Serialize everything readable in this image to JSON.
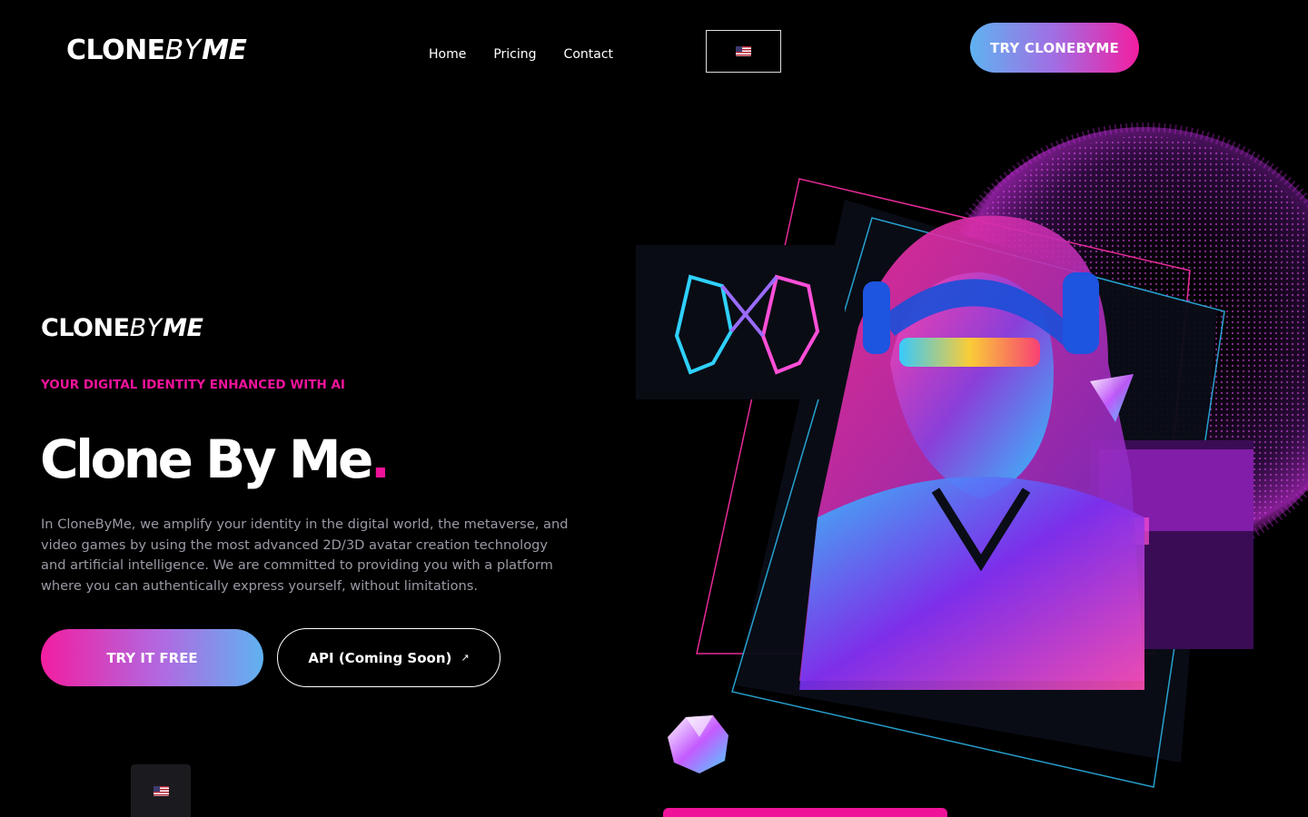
{
  "header": {
    "logo": {
      "clone": "CLONE",
      "by": "BY",
      "me": "ME"
    },
    "nav": [
      {
        "label": "Home"
      },
      {
        "label": "Pricing"
      },
      {
        "label": "Contact"
      }
    ],
    "language_icon": "us-flag-icon",
    "cta_label": "TRY CLONEBYME"
  },
  "hero": {
    "logo": {
      "clone": "CLONE",
      "by": "BY",
      "me": "ME"
    },
    "tagline": "YOUR DIGITAL IDENTITY ENHANCED WITH AI",
    "headline": "Clone By Me",
    "headline_dot": ".",
    "description": "In CloneByMe, we amplify your identity in the digital world, the metaverse, and video games by using the most advanced 2D/3D avatar creation technology and artificial intelligence. We are committed to providing you with a platform where you can authentically express yourself, without limitations.",
    "primary_button": "TRY IT FREE",
    "secondary_button": "API (Coming Soon)",
    "secondary_icon": "external-arrow-icon"
  },
  "language_switcher": {
    "icon": "us-flag-icon"
  },
  "colors": {
    "accent_pink": "#f0139a",
    "accent_blue": "#5fb2f0",
    "accent_purple": "#a26de3",
    "background": "#000000",
    "body_text": "#9a9aa6"
  }
}
